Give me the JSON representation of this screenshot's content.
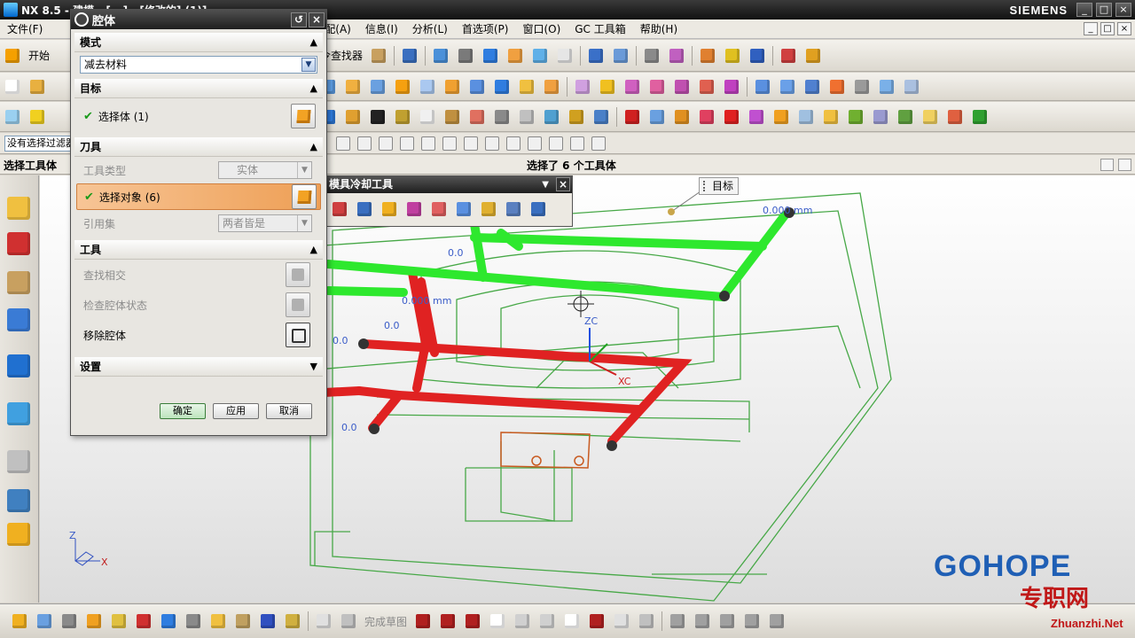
{
  "window": {
    "title": "NX 8.5 - 建模 - [...] - [修改的] (1)]",
    "brand": "SIEMENS",
    "controls": [
      "_",
      "□",
      "×"
    ]
  },
  "menu": {
    "items": [
      "文件(F)",
      "装配(A)",
      "信息(I)",
      "分析(L)",
      "首选项(P)",
      "窗口(O)",
      "GC 工具箱",
      "帮助(H)"
    ],
    "start_label": "开始",
    "command_finder": "命令查找器"
  },
  "filter": {
    "value": "没有选择过滤器"
  },
  "cue": {
    "left": "选择工具体",
    "center": "选择了 6 个工具体"
  },
  "dialog": {
    "title": "腔体",
    "reset": "↺",
    "close": "×",
    "mode": {
      "header": "模式",
      "value": "减去材料"
    },
    "target": {
      "header": "目标",
      "select_body": "选择体 (1)"
    },
    "tool": {
      "header": "刀具",
      "tool_type_label": "工具类型",
      "tool_type_value": "实体",
      "select_object": "选择对象 (6)",
      "ref_set_label": "引用集",
      "ref_set_value": "两者皆是"
    },
    "tools": {
      "header": "工具",
      "find_intersect": "查找相交",
      "check_status": "检查腔体状态",
      "remove_cavity": "移除腔体"
    },
    "settings": {
      "header": "设置"
    },
    "buttons": {
      "ok": "确定",
      "apply": "应用",
      "cancel": "取消"
    }
  },
  "cooling_toolbar": {
    "title": "模具冷却工具"
  },
  "viewport": {
    "tag": "目标",
    "dimension": "0.000 mm",
    "dimension_short": "0.0",
    "axis_zc": "ZC",
    "axis_xc": "XC",
    "triad_z": "Z",
    "triad_x": "X",
    "finish_sketch": "完成草图"
  },
  "watermark": {
    "logo": "GOHOPE",
    "tagline": "专职网",
    "url": "Zhuanzhi.Net"
  },
  "colors": {
    "accent_highlight": "#ee9f55",
    "cooling_green": "#2ee82e",
    "cooling_red": "#e02222",
    "wireframe": "#47a847",
    "logo_blue": "#1f5fb5"
  }
}
